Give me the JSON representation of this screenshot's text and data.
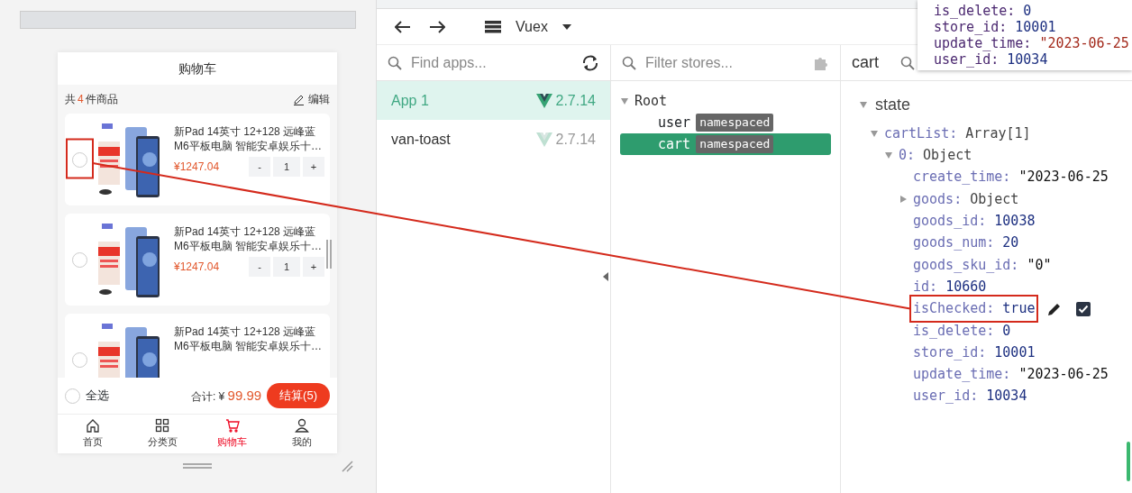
{
  "phone": {
    "title": "购物车",
    "summary": {
      "prefix": "共",
      "count": "4",
      "suffix": "件商品"
    },
    "edit_label": "编辑",
    "items": [
      {
        "title": "新Pad 14英寸 12+128 远峰蓝 M6平板电脑 智能安卓娱乐十…",
        "price": "¥1247.04",
        "decrement": "-",
        "quantity": "1",
        "increment": "+",
        "checked": false
      },
      {
        "title": "新Pad 14英寸 12+128 远峰蓝 M6平板电脑 智能安卓娱乐十…",
        "price": "¥1247.04",
        "decrement": "-",
        "quantity": "1",
        "increment": "+",
        "checked": false
      },
      {
        "title": "新Pad 14英寸 12+128 远峰蓝 M6平板电脑 智能安卓娱乐十…",
        "checked": false
      }
    ],
    "footer": {
      "select_all": {
        "label": "全选",
        "checked": false
      },
      "total_label": "合计:",
      "currency": "¥",
      "total": "99.99",
      "checkout": "结算(5)"
    },
    "tabbar": [
      {
        "label": "首页",
        "kind": "home",
        "selected": false
      },
      {
        "label": "分类页",
        "kind": "grid",
        "selected": false
      },
      {
        "label": "购物车",
        "kind": "cart",
        "selected": true
      },
      {
        "label": "我的",
        "kind": "user",
        "selected": false
      }
    ]
  },
  "devtools": {
    "inspector": "Vuex",
    "apps_search": {
      "placeholder": "Find apps..."
    },
    "apps": [
      {
        "name": "App 1",
        "version": "2.7.14",
        "selected": true
      },
      {
        "name": "van-toast",
        "version": "2.7.14",
        "selected": false
      }
    ],
    "stores_search": {
      "placeholder": "Filter stores..."
    },
    "stores": {
      "label": "Root",
      "expanded": true,
      "children": [
        {
          "label": "user",
          "tag": "namespaced",
          "selected": false
        },
        {
          "label": "cart",
          "tag": "namespaced",
          "selected": true
        }
      ]
    },
    "state_panel": {
      "title": "cart",
      "section": {
        "title": "state",
        "expanded": true,
        "nodes": [
          {
            "key": "cartList:",
            "value": "Array[1]",
            "kind": "object",
            "expanded": true,
            "children": [
              {
                "key": "0:",
                "value": "Object",
                "kind": "object",
                "expanded": true,
                "children": [
                  {
                    "key": "create_time:",
                    "value": "\"2023-06-25",
                    "kind": "string"
                  },
                  {
                    "key": "goods:",
                    "value": "Object",
                    "kind": "object",
                    "expanded": false
                  },
                  {
                    "key": "goods_id:",
                    "value": "10038",
                    "kind": "number"
                  },
                  {
                    "key": "goods_num:",
                    "value": "20",
                    "kind": "number"
                  },
                  {
                    "key": "goods_sku_id:",
                    "value": "\"0\"",
                    "kind": "string"
                  },
                  {
                    "key": "id:",
                    "value": "10660",
                    "kind": "number"
                  },
                  {
                    "key": "isChecked:",
                    "value": "true",
                    "kind": "number",
                    "hovered": true,
                    "highlighted": true
                  },
                  {
                    "key": "is_delete:",
                    "value": "0",
                    "kind": "number"
                  },
                  {
                    "key": "store_id:",
                    "value": "10001",
                    "kind": "number"
                  },
                  {
                    "key": "update_time:",
                    "value": "\"2023-06-25",
                    "kind": "string"
                  },
                  {
                    "key": "user_id:",
                    "value": "10034",
                    "kind": "number"
                  }
                ]
              }
            ]
          }
        ]
      }
    },
    "tooltip": [
      {
        "key": "is_delete:",
        "value": "0",
        "kind": "number"
      },
      {
        "key": "store_id:",
        "value": "10001",
        "kind": "number"
      },
      {
        "key": "update_time:",
        "value": "\"2023-06-25",
        "kind": "string"
      },
      {
        "key": "user_id:",
        "value": "10034",
        "kind": "number"
      }
    ]
  }
}
